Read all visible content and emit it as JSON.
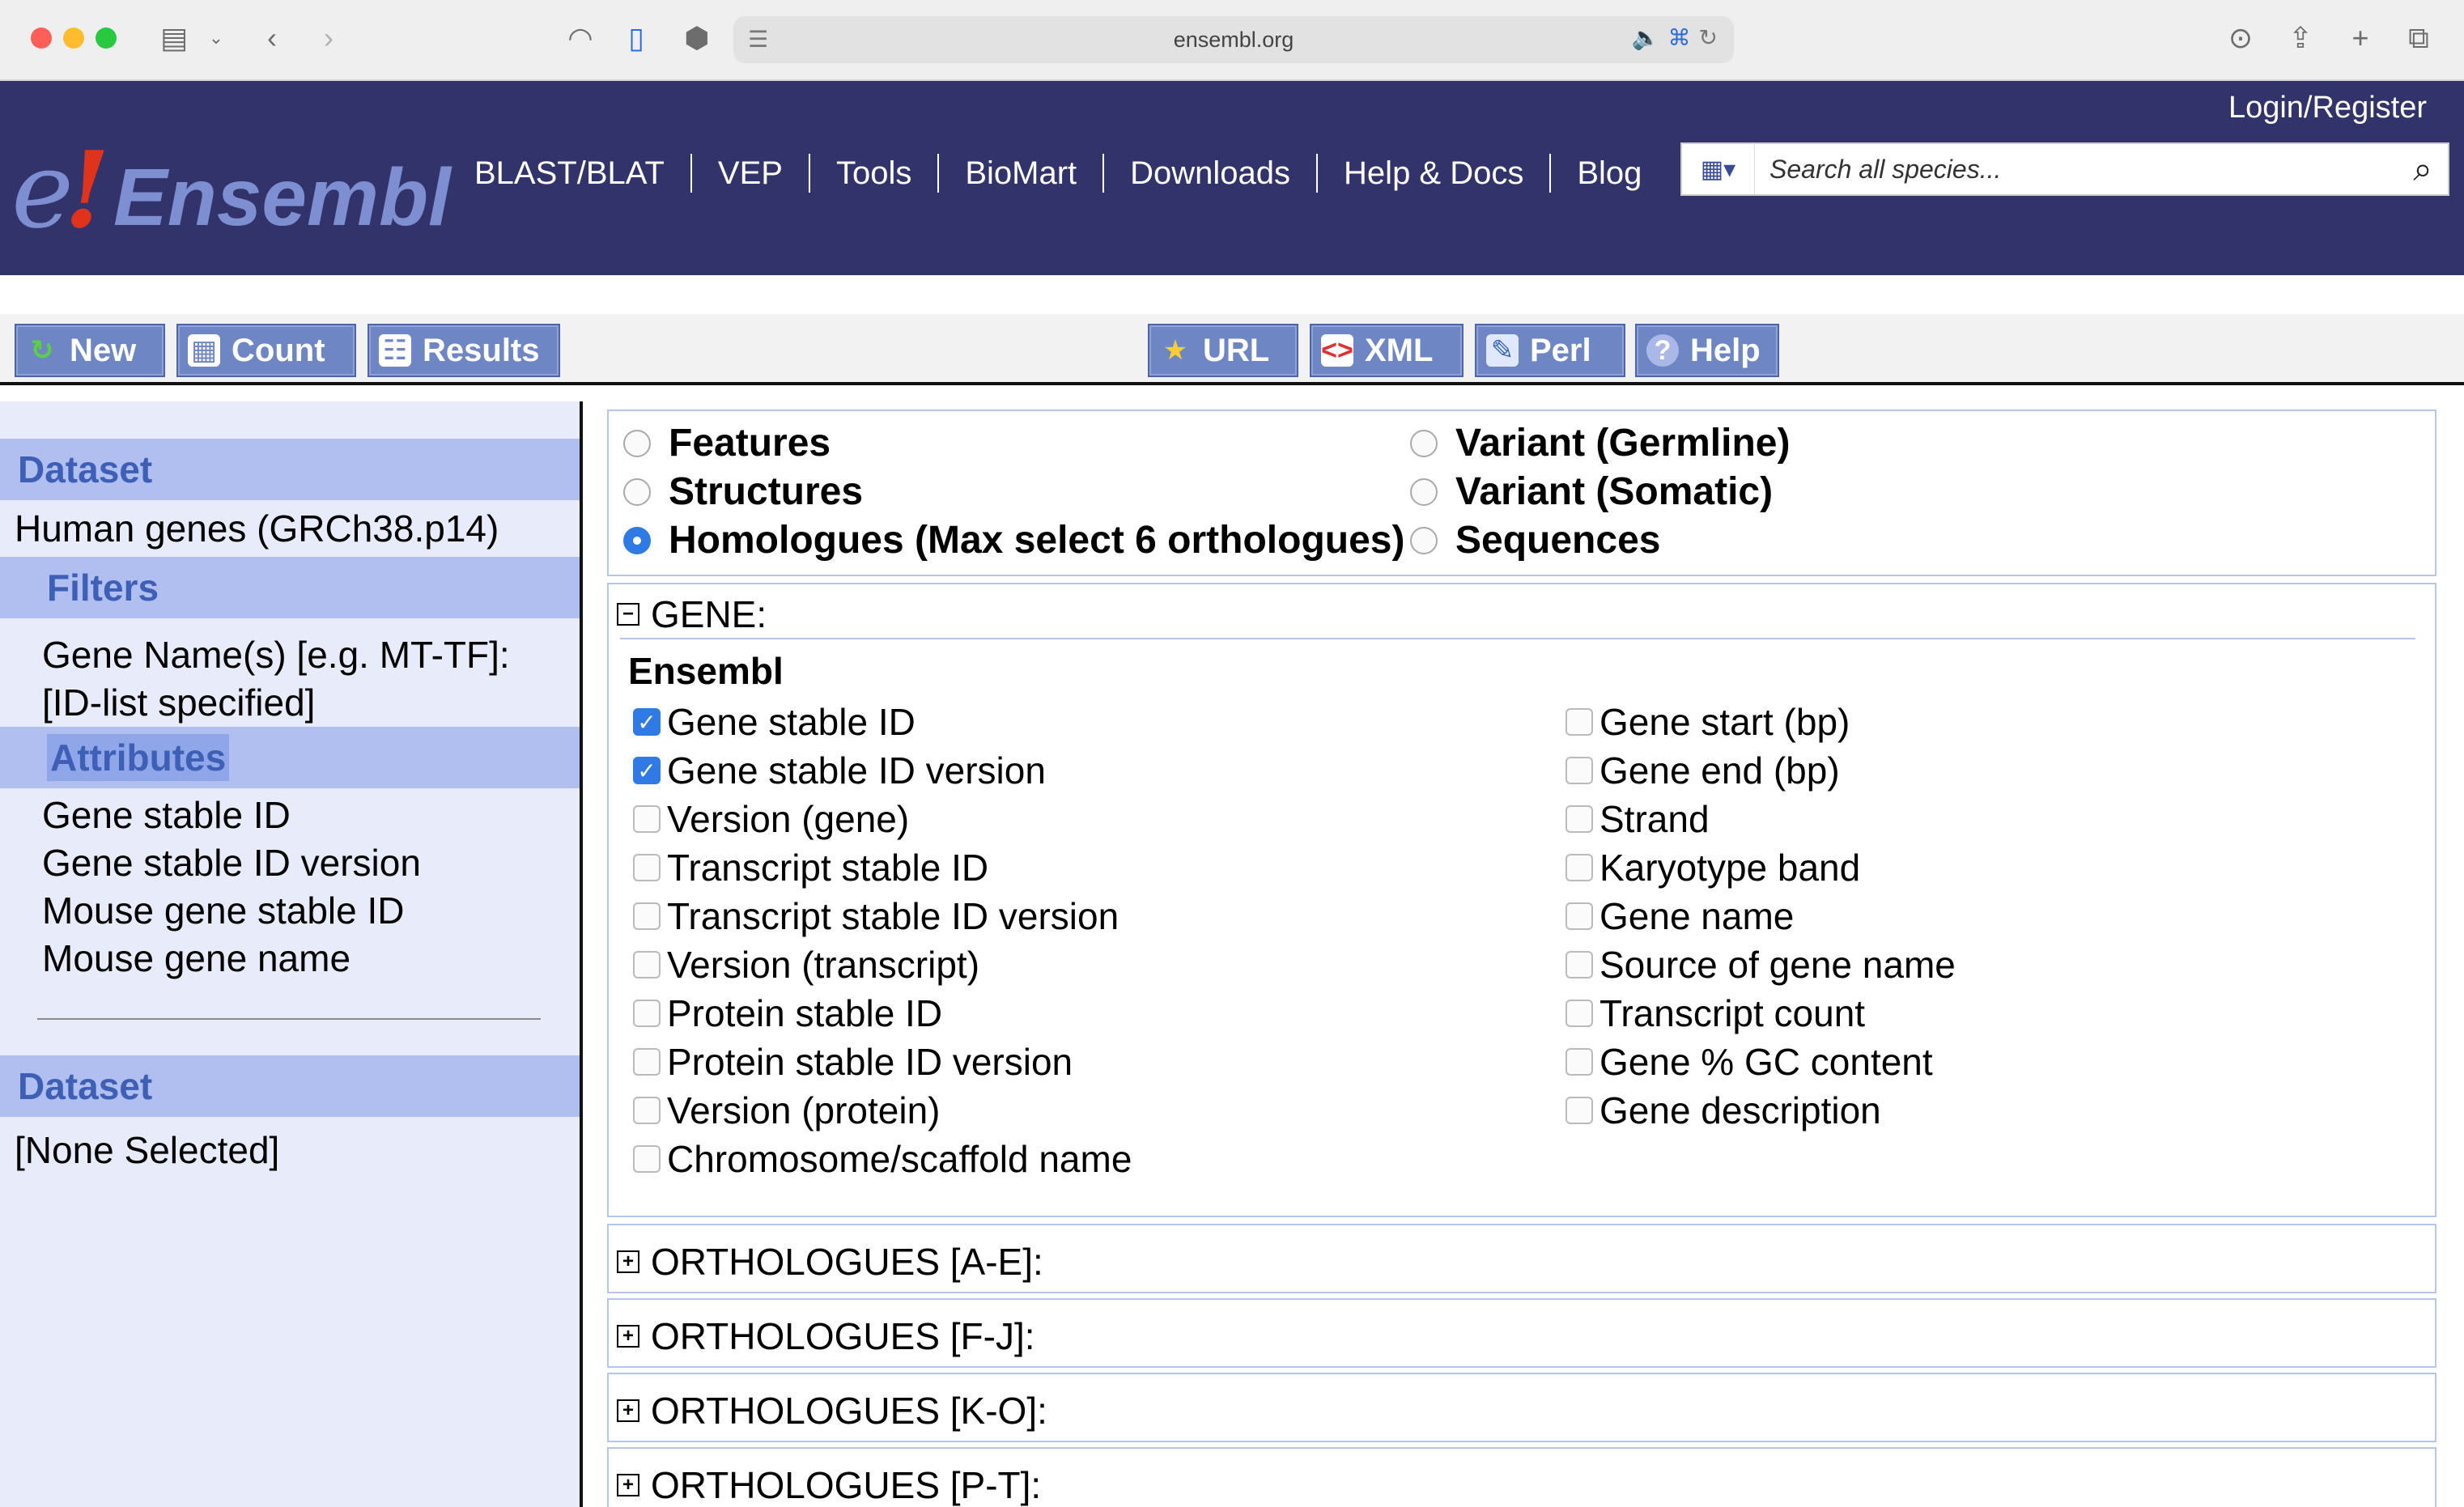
{
  "browser": {
    "url": "ensembl.org"
  },
  "header": {
    "logo_e": "e",
    "logo_bang": "!",
    "logo_word": "Ensembl",
    "nav": [
      "BLAST/BLAT",
      "VEP",
      "Tools",
      "BioMart",
      "Downloads",
      "Help & Docs",
      "Blog"
    ],
    "login": "Login/Register",
    "search_placeholder": "Search all species..."
  },
  "toolbar": {
    "left": [
      "New",
      "Count",
      "Results"
    ],
    "right": [
      "URL",
      "XML",
      "Perl",
      "Help"
    ]
  },
  "sidebar": {
    "dataset_heading": "Dataset",
    "dataset_value": "Human genes (GRCh38.p14)",
    "filters_heading": "Filters",
    "filter_line1": "Gene Name(s) [e.g. MT-TF]:",
    "filter_line2": "[ID-list specified]",
    "attributes_heading": "Attributes",
    "attributes": [
      "Gene stable ID",
      "Gene stable ID version",
      "Mouse gene stable ID",
      "Mouse gene name"
    ],
    "dataset2_heading": "Dataset",
    "dataset2_value": "[None Selected]"
  },
  "attribute_pages": {
    "left": [
      "Features",
      "Structures",
      "Homologues (Max select 6 orthologues)"
    ],
    "right": [
      "Variant (Germline)",
      "Variant (Somatic)",
      "Sequences"
    ],
    "selected": "Homologues (Max select 6 orthologues)"
  },
  "gene_section": {
    "title": "GENE:",
    "group": "Ensembl",
    "left_attrs": [
      {
        "label": "Gene stable ID",
        "checked": true
      },
      {
        "label": "Gene stable ID version",
        "checked": true
      },
      {
        "label": "Version (gene)",
        "checked": false
      },
      {
        "label": "Transcript stable ID",
        "checked": false
      },
      {
        "label": "Transcript stable ID version",
        "checked": false
      },
      {
        "label": "Version (transcript)",
        "checked": false
      },
      {
        "label": "Protein stable ID",
        "checked": false
      },
      {
        "label": "Protein stable ID version",
        "checked": false
      },
      {
        "label": "Version (protein)",
        "checked": false
      },
      {
        "label": "Chromosome/scaffold name",
        "checked": false
      }
    ],
    "right_attrs": [
      {
        "label": "Gene start (bp)",
        "checked": false
      },
      {
        "label": "Gene end (bp)",
        "checked": false
      },
      {
        "label": "Strand",
        "checked": false
      },
      {
        "label": "Karyotype band",
        "checked": false
      },
      {
        "label": "Gene name",
        "checked": false
      },
      {
        "label": "Source of gene name",
        "checked": false
      },
      {
        "label": "Transcript count",
        "checked": false
      },
      {
        "label": "Gene % GC content",
        "checked": false
      },
      {
        "label": "Gene description",
        "checked": false
      }
    ]
  },
  "ortholog_sections": [
    "ORTHOLOGUES [A-E]:",
    "ORTHOLOGUES [F-J]:",
    "ORTHOLOGUES [K-O]:",
    "ORTHOLOGUES [P-T]:"
  ],
  "colors": {
    "header_bg": "#33336b",
    "button_bg": "#6f86c4",
    "sidebar_bg": "#e8ebfa",
    "sidebar_heading_bg": "#b1bff0",
    "checkbox_on": "#2f7ae5"
  }
}
